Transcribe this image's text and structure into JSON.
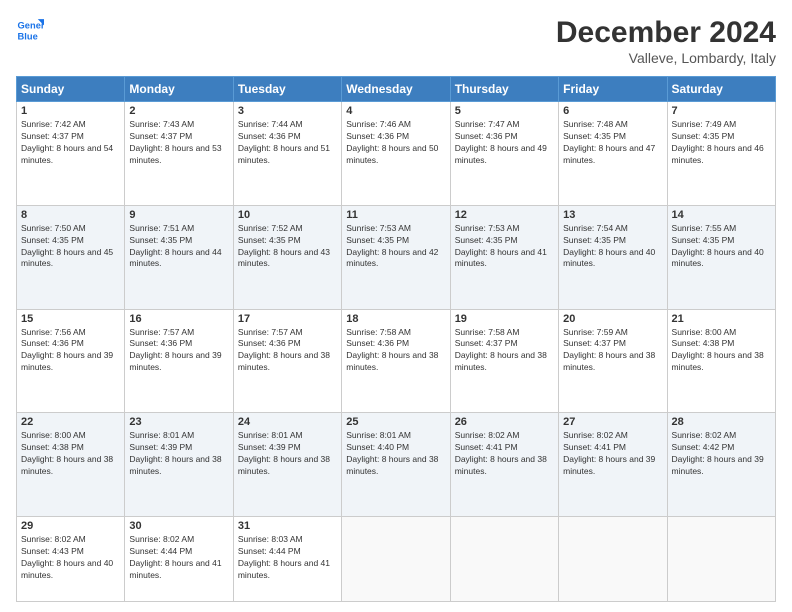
{
  "header": {
    "logo_line1": "General",
    "logo_line2": "Blue",
    "month_title": "December 2024",
    "location": "Valleve, Lombardy, Italy"
  },
  "weekdays": [
    "Sunday",
    "Monday",
    "Tuesday",
    "Wednesday",
    "Thursday",
    "Friday",
    "Saturday"
  ],
  "weeks": [
    [
      {
        "day": "1",
        "sunrise": "7:42 AM",
        "sunset": "4:37 PM",
        "daylight": "8 hours and 54 minutes."
      },
      {
        "day": "2",
        "sunrise": "7:43 AM",
        "sunset": "4:37 PM",
        "daylight": "8 hours and 53 minutes."
      },
      {
        "day": "3",
        "sunrise": "7:44 AM",
        "sunset": "4:36 PM",
        "daylight": "8 hours and 51 minutes."
      },
      {
        "day": "4",
        "sunrise": "7:46 AM",
        "sunset": "4:36 PM",
        "daylight": "8 hours and 50 minutes."
      },
      {
        "day": "5",
        "sunrise": "7:47 AM",
        "sunset": "4:36 PM",
        "daylight": "8 hours and 49 minutes."
      },
      {
        "day": "6",
        "sunrise": "7:48 AM",
        "sunset": "4:35 PM",
        "daylight": "8 hours and 47 minutes."
      },
      {
        "day": "7",
        "sunrise": "7:49 AM",
        "sunset": "4:35 PM",
        "daylight": "8 hours and 46 minutes."
      }
    ],
    [
      {
        "day": "8",
        "sunrise": "7:50 AM",
        "sunset": "4:35 PM",
        "daylight": "8 hours and 45 minutes."
      },
      {
        "day": "9",
        "sunrise": "7:51 AM",
        "sunset": "4:35 PM",
        "daylight": "8 hours and 44 minutes."
      },
      {
        "day": "10",
        "sunrise": "7:52 AM",
        "sunset": "4:35 PM",
        "daylight": "8 hours and 43 minutes."
      },
      {
        "day": "11",
        "sunrise": "7:53 AM",
        "sunset": "4:35 PM",
        "daylight": "8 hours and 42 minutes."
      },
      {
        "day": "12",
        "sunrise": "7:53 AM",
        "sunset": "4:35 PM",
        "daylight": "8 hours and 41 minutes."
      },
      {
        "day": "13",
        "sunrise": "7:54 AM",
        "sunset": "4:35 PM",
        "daylight": "8 hours and 40 minutes."
      },
      {
        "day": "14",
        "sunrise": "7:55 AM",
        "sunset": "4:35 PM",
        "daylight": "8 hours and 40 minutes."
      }
    ],
    [
      {
        "day": "15",
        "sunrise": "7:56 AM",
        "sunset": "4:36 PM",
        "daylight": "8 hours and 39 minutes."
      },
      {
        "day": "16",
        "sunrise": "7:57 AM",
        "sunset": "4:36 PM",
        "daylight": "8 hours and 39 minutes."
      },
      {
        "day": "17",
        "sunrise": "7:57 AM",
        "sunset": "4:36 PM",
        "daylight": "8 hours and 38 minutes."
      },
      {
        "day": "18",
        "sunrise": "7:58 AM",
        "sunset": "4:36 PM",
        "daylight": "8 hours and 38 minutes."
      },
      {
        "day": "19",
        "sunrise": "7:58 AM",
        "sunset": "4:37 PM",
        "daylight": "8 hours and 38 minutes."
      },
      {
        "day": "20",
        "sunrise": "7:59 AM",
        "sunset": "4:37 PM",
        "daylight": "8 hours and 38 minutes."
      },
      {
        "day": "21",
        "sunrise": "8:00 AM",
        "sunset": "4:38 PM",
        "daylight": "8 hours and 38 minutes."
      }
    ],
    [
      {
        "day": "22",
        "sunrise": "8:00 AM",
        "sunset": "4:38 PM",
        "daylight": "8 hours and 38 minutes."
      },
      {
        "day": "23",
        "sunrise": "8:01 AM",
        "sunset": "4:39 PM",
        "daylight": "8 hours and 38 minutes."
      },
      {
        "day": "24",
        "sunrise": "8:01 AM",
        "sunset": "4:39 PM",
        "daylight": "8 hours and 38 minutes."
      },
      {
        "day": "25",
        "sunrise": "8:01 AM",
        "sunset": "4:40 PM",
        "daylight": "8 hours and 38 minutes."
      },
      {
        "day": "26",
        "sunrise": "8:02 AM",
        "sunset": "4:41 PM",
        "daylight": "8 hours and 38 minutes."
      },
      {
        "day": "27",
        "sunrise": "8:02 AM",
        "sunset": "4:41 PM",
        "daylight": "8 hours and 39 minutes."
      },
      {
        "day": "28",
        "sunrise": "8:02 AM",
        "sunset": "4:42 PM",
        "daylight": "8 hours and 39 minutes."
      }
    ],
    [
      {
        "day": "29",
        "sunrise": "8:02 AM",
        "sunset": "4:43 PM",
        "daylight": "8 hours and 40 minutes."
      },
      {
        "day": "30",
        "sunrise": "8:02 AM",
        "sunset": "4:44 PM",
        "daylight": "8 hours and 41 minutes."
      },
      {
        "day": "31",
        "sunrise": "8:03 AM",
        "sunset": "4:44 PM",
        "daylight": "8 hours and 41 minutes."
      },
      null,
      null,
      null,
      null
    ]
  ]
}
